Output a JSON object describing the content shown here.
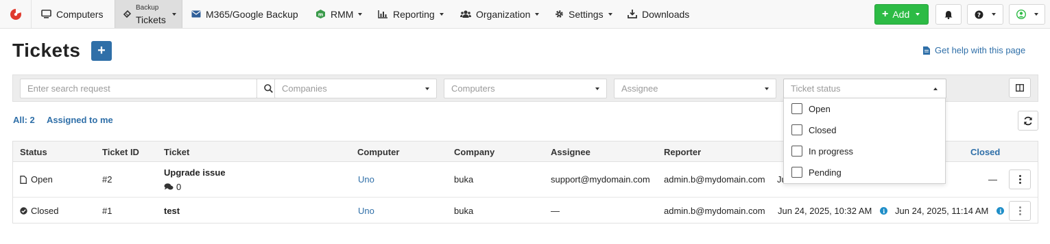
{
  "nav": {
    "items": [
      {
        "label": "Computers",
        "icon": "monitor-icon"
      },
      {
        "label_small": "Backup",
        "label": "Tickets",
        "icon": "ticket-icon"
      },
      {
        "label": "M365/Google Backup",
        "icon": "envelope-icon"
      },
      {
        "label": "RMM",
        "icon": "rmm-icon"
      },
      {
        "label": "Reporting",
        "icon": "bar-chart-icon"
      },
      {
        "label": "Organization",
        "icon": "users-icon"
      },
      {
        "label": "Settings",
        "icon": "gear-icon"
      },
      {
        "label": "Downloads",
        "icon": "download-icon"
      }
    ],
    "add_label": "Add"
  },
  "header": {
    "title": "Tickets",
    "help_link": "Get help with this page"
  },
  "filters": {
    "search_placeholder": "Enter search request",
    "companies_placeholder": "Companies",
    "computers_placeholder": "Computers",
    "assignee_placeholder": "Assignee",
    "status_placeholder": "Ticket status"
  },
  "status_options": [
    "Open",
    "Closed",
    "In progress",
    "Pending"
  ],
  "counts": {
    "all": "All: 2",
    "assigned": "Assigned to me"
  },
  "table": {
    "columns": [
      "Status",
      "Ticket ID",
      "Ticket",
      "Computer",
      "Company",
      "Assignee",
      "Reporter",
      "Closed"
    ],
    "rows": [
      {
        "status": "Open",
        "id": "#2",
        "ticket": "Upgrade issue",
        "comments": "0",
        "computer": "Uno",
        "company": "buka",
        "assignee": "support@mydomain.com",
        "reporter": "admin.b@mydomain.com",
        "created_partial": "Ju",
        "closed": "—"
      },
      {
        "status": "Closed",
        "id": "#1",
        "ticket": "test",
        "computer": "Uno",
        "company": "buka",
        "assignee": "—",
        "reporter": "admin.b@mydomain.com",
        "created": "Jun 24, 2025, 10:32 AM",
        "closed": "Jun 24, 2025, 11:14 AM"
      }
    ]
  },
  "colors": {
    "accent": "#2f6fa8",
    "add_green": "#2dbb45",
    "info_blue": "#1f8ec8"
  }
}
